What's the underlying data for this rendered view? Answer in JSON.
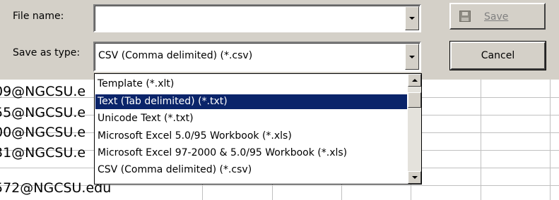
{
  "dialog": {
    "file_name_label": "File name:",
    "file_name_value": "",
    "save_as_type_label": "Save as type:",
    "save_as_type_value": "CSV (Comma delimited) (*.csv)",
    "save_label": "Save",
    "cancel_label": "Cancel"
  },
  "dropdown": {
    "options": [
      "Template (*.xlt)",
      "Text (Tab delimited) (*.txt)",
      "Unicode Text (*.txt)",
      "Microsoft Excel 5.0/95 Workbook (*.xls)",
      "Microsoft Excel 97-2000 & 5.0/95 Workbook (*.xls)",
      "CSV (Comma delimited) (*.csv)"
    ],
    "selected_index": 1,
    "selection_color": "#0a246a"
  },
  "sheet": {
    "cells": [
      "09@NGCSU.e",
      "55@NGCSU.e",
      "00@NGCSU.e",
      "31@NGCSU.e",
      "572@NGCSU.edu"
    ]
  },
  "icons": {
    "save": "floppy-disk-icon",
    "dropdown": "chevron-down-icon"
  }
}
